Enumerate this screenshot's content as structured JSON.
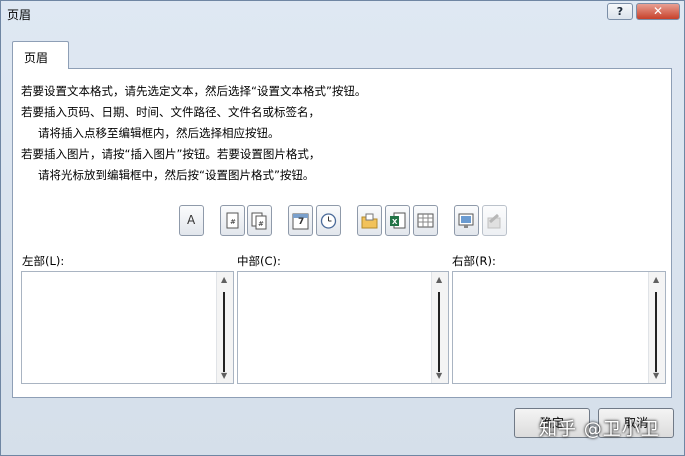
{
  "window": {
    "title": "页眉"
  },
  "titlebar": {
    "help_label": "?",
    "close_label": "✕"
  },
  "tab": {
    "label": "页眉"
  },
  "instructions": [
    "若要设置文本格式，请先选定文本，然后选择“设置文本格式”按钮。",
    "若要插入页码、日期、时间、文件路径、文件名或标签名，",
    "请将插入点移至编辑框内，然后选择相应按钮。",
    "若要插入图片，请按“插入图片”按钮。若要设置图片格式，",
    "请将光标放到编辑框中，然后按“设置图片格式”按钮。"
  ],
  "toolbar": {
    "font_glyph": "A",
    "date_glyph": "7"
  },
  "sections": {
    "left": "左部(L):",
    "center": "中部(C):",
    "right": "右部(R):"
  },
  "buttons": {
    "ok": "确定",
    "cancel": "取消"
  },
  "watermark": "知乎 @卫小卫"
}
